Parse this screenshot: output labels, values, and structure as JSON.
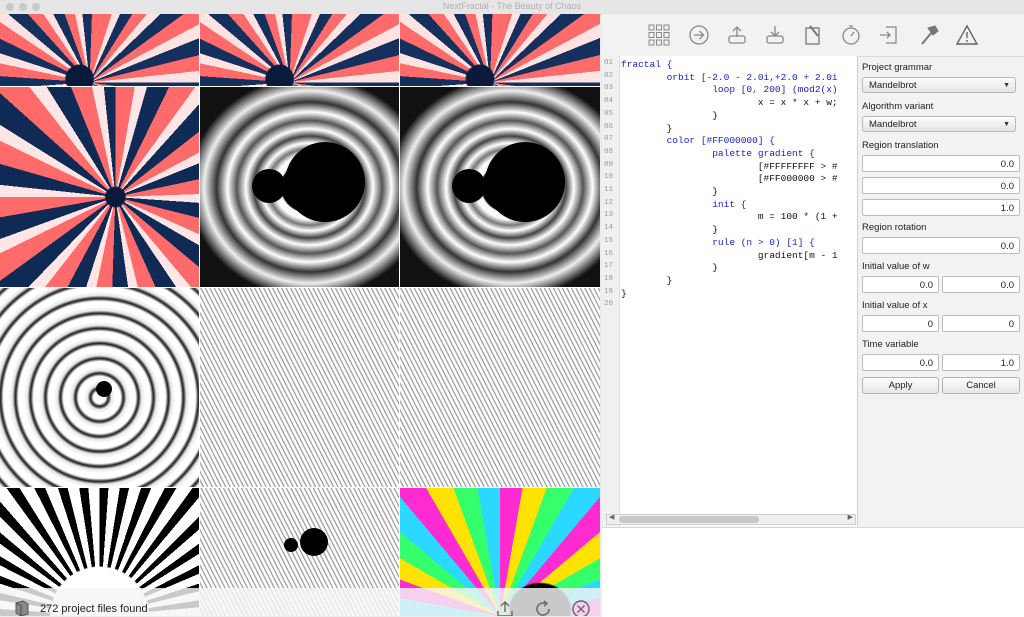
{
  "window": {
    "title": "NextFractal - The Beauty of Chaos",
    "traffic_lights": [
      "close",
      "minimize",
      "zoom"
    ]
  },
  "gallery": {
    "status": "272 project files found",
    "thumbnails": [
      {
        "name": "fractal-thumbnail",
        "style": "red-blue-spiral"
      },
      {
        "name": "fractal-thumbnail",
        "style": "red-blue-spiral"
      },
      {
        "name": "fractal-thumbnail",
        "style": "red-blue-spiral"
      },
      {
        "name": "fractal-thumbnail",
        "style": "red-blue-spiral-large"
      },
      {
        "name": "fractal-thumbnail",
        "style": "grey-mandelbrot"
      },
      {
        "name": "fractal-thumbnail",
        "style": "grey-mandelbrot"
      },
      {
        "name": "fractal-thumbnail",
        "style": "grey-stripes"
      },
      {
        "name": "fractal-thumbnail",
        "style": "grey-noise"
      },
      {
        "name": "fractal-thumbnail",
        "style": "grey-noise"
      },
      {
        "name": "fractal-thumbnail",
        "style": "black-white-spiral"
      },
      {
        "name": "fractal-thumbnail",
        "style": "grey-noise-mandelbrot"
      },
      {
        "name": "fractal-thumbnail",
        "style": "rainbow-mandelbrot"
      }
    ],
    "footer_icons": [
      "browser-icon",
      "export-icon",
      "refresh-icon",
      "stop-icon"
    ]
  },
  "toolbar": {
    "icons": [
      "grid-icon",
      "jump-icon",
      "export-icon",
      "import-icon",
      "edit-icon",
      "timer-icon",
      "open-icon",
      "build-icon",
      "warning-icon"
    ]
  },
  "editor": {
    "lines": [
      {
        "num": "01",
        "text": "fractal {"
      },
      {
        "num": "02",
        "text": "        orbit [-2.0 - 2.0i,+2.0 + 2.0i"
      },
      {
        "num": "03",
        "text": "                loop [0, 200] (mod2(x)"
      },
      {
        "num": "04",
        "text": "                        x = x * x + w;"
      },
      {
        "num": "05",
        "text": "                }"
      },
      {
        "num": "06",
        "text": "        }"
      },
      {
        "num": "07",
        "text": "        color [#FF000000] {"
      },
      {
        "num": "08",
        "text": "                palette gradient {"
      },
      {
        "num": "09",
        "text": "                        [#FFFFFFFF > #"
      },
      {
        "num": "10",
        "text": "                        [#FF000000 > #"
      },
      {
        "num": "11",
        "text": "                }"
      },
      {
        "num": "12",
        "text": "                init {"
      },
      {
        "num": "13",
        "text": "                        m = 100 * (1 +"
      },
      {
        "num": "14",
        "text": "                }"
      },
      {
        "num": "15",
        "text": "                rule (n > 0) [1] {"
      },
      {
        "num": "16",
        "text": "                        gradient[m - 1"
      },
      {
        "num": "17",
        "text": "                }"
      },
      {
        "num": "18",
        "text": "        }"
      },
      {
        "num": "19",
        "text": "}"
      },
      {
        "num": "20",
        "text": ""
      }
    ]
  },
  "params": {
    "grammar_label": "Project grammar",
    "grammar_value": "Mandelbrot",
    "variant_label": "Algorithm variant",
    "variant_value": "Mandelbrot",
    "translation_label": "Region translation",
    "translation": [
      "0.0",
      "0.0",
      "1.0"
    ],
    "rotation_label": "Region rotation",
    "rotation": "0.0",
    "w_label": "Initial value of w",
    "w": [
      "0.0",
      "0.0"
    ],
    "x_label": "Initial value of x",
    "x": [
      "0",
      "0"
    ],
    "time_label": "Time variable",
    "time": [
      "0.0",
      "1.0"
    ],
    "apply": "Apply",
    "cancel": "Cancel"
  }
}
